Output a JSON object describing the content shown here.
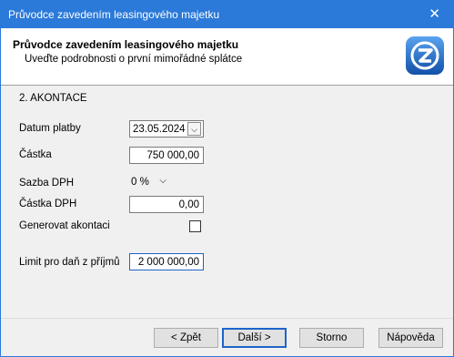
{
  "window": {
    "title": "Průvodce zavedením leasingového majetku",
    "close_glyph": "✕"
  },
  "header": {
    "title": "Průvodce zavedením leasingového majetku",
    "subtitle": "Uveďte podrobnosti o první mimořádné splátce"
  },
  "section_title": "2. AKONTACE",
  "fields": {
    "datum_platby": {
      "label": "Datum platby",
      "value": "23.05.2024"
    },
    "castka": {
      "label": "Částka",
      "value": "750 000,00"
    },
    "sazba_dph": {
      "label": "Sazba DPH",
      "value": "0 %"
    },
    "castka_dph": {
      "label": "Částka DPH",
      "value": "0,00"
    },
    "generovat_akontaci": {
      "label": "Generovat akontaci",
      "checked": false
    },
    "limit": {
      "label": "Limit pro daň z příjmů",
      "value": "2 000 000,00"
    }
  },
  "buttons": {
    "back": "< Zpět",
    "next": "Další >",
    "cancel": "Storno",
    "help": "Nápověda"
  },
  "colors": {
    "titlebar": "#2b79d8",
    "logo": "#1f6bd0",
    "accent": "#1e64c8"
  }
}
